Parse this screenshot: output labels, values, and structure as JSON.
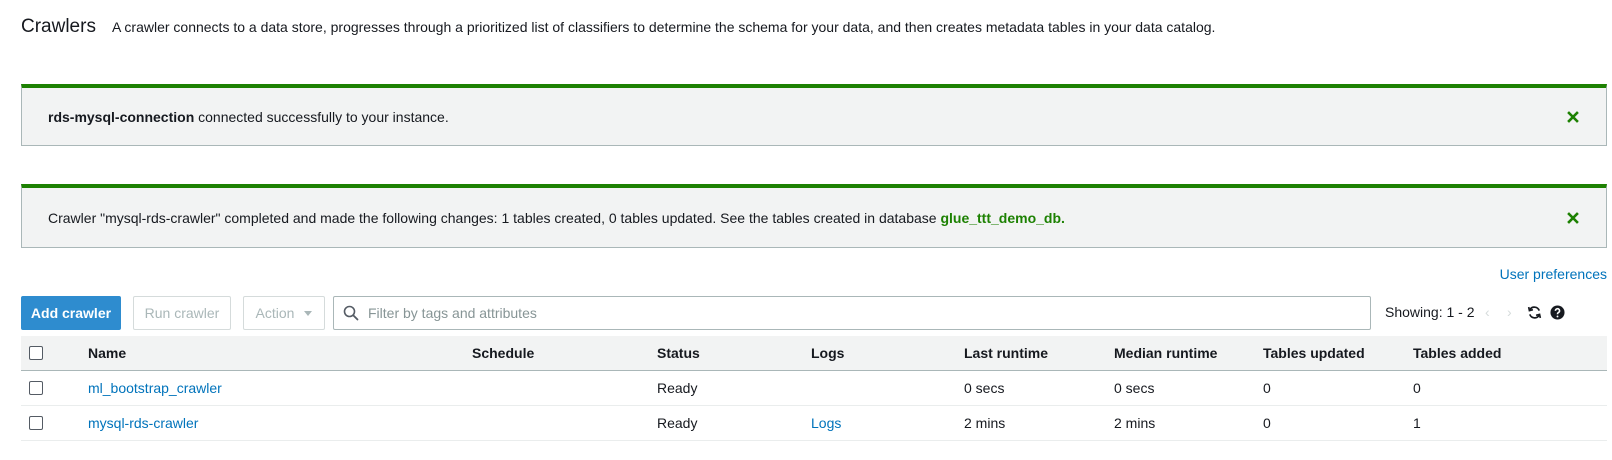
{
  "header": {
    "title": "Crawlers",
    "description": "A crawler connects to a data store, progresses through a prioritized list of classifiers to determine the schema for your data, and then creates metadata tables in your data catalog."
  },
  "flash_connection": {
    "bold": "rds-mysql-connection",
    "text": " connected successfully to your instance."
  },
  "flash_crawler": {
    "text": "Crawler \"mysql-rds-crawler\" completed and made the following changes: 1 tables created, 0 tables updated. See the tables created in database ",
    "db_link": "glue_ttt_demo_db."
  },
  "user_preferences": "User preferences",
  "toolbar": {
    "add_label": "Add crawler",
    "run_label": "Run crawler",
    "action_label": "Action",
    "search_placeholder": "Filter by tags and attributes",
    "showing": "Showing: 1 - 2",
    "prev": "‹",
    "next": "›"
  },
  "table": {
    "columns": {
      "name": "Name",
      "schedule": "Schedule",
      "status": "Status",
      "logs": "Logs",
      "last_runtime": "Last runtime",
      "median_runtime": "Median runtime",
      "tables_updated": "Tables updated",
      "tables_added": "Tables added"
    },
    "rows": [
      {
        "name": "ml_bootstrap_crawler",
        "schedule": "",
        "status": "Ready",
        "logs": "",
        "last_runtime": "0 secs",
        "median_runtime": "0 secs",
        "tables_updated": "0",
        "tables_added": "0"
      },
      {
        "name": "mysql-rds-crawler",
        "schedule": "",
        "status": "Ready",
        "logs": "Logs",
        "last_runtime": "2 mins",
        "median_runtime": "2 mins",
        "tables_updated": "0",
        "tables_added": "1"
      }
    ]
  },
  "colors": {
    "success": "#1d8102",
    "primary": "#2e8ccf",
    "link": "#0073bb"
  },
  "icons": {
    "close": "close-icon",
    "search": "search-icon",
    "refresh": "refresh-icon",
    "help": "help-icon"
  }
}
